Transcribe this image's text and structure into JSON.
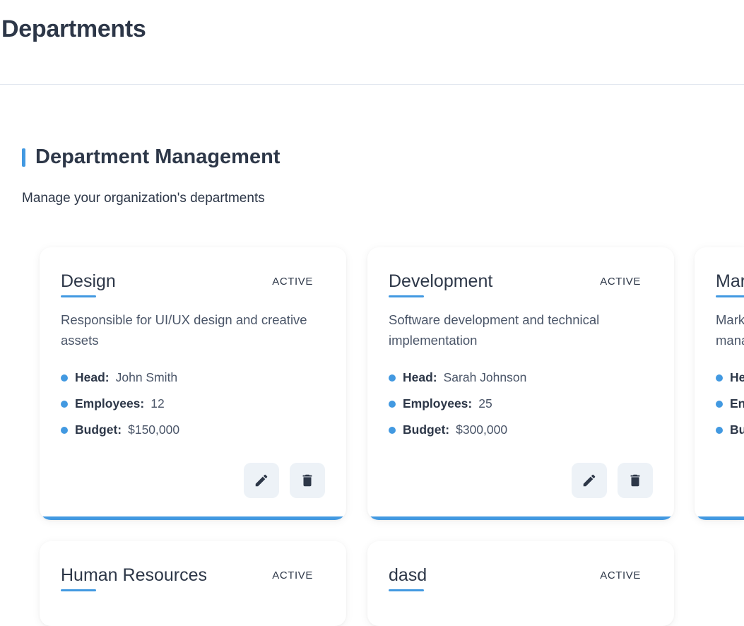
{
  "header": {
    "title": "Departments"
  },
  "section": {
    "title": "Department Management",
    "subtitle": "Manage your organization's departments"
  },
  "labels": {
    "head": "Head:",
    "employees": "Employees:",
    "budget": "Budget:"
  },
  "colors": {
    "accent": "#4299e1",
    "text": "#2d3748",
    "muted": "#4a5568",
    "button_bg": "#edf2f7"
  },
  "icons": {
    "edit": "pencil-icon",
    "delete": "trash-icon"
  },
  "departments": [
    {
      "name": "Design",
      "status": "ACTIVE",
      "description": "Responsible for UI/UX design and creative assets",
      "head": "John Smith",
      "employees": "12",
      "budget": "$150,000"
    },
    {
      "name": "Development",
      "status": "ACTIVE",
      "description": "Software development and technical implementation",
      "head": "Sarah Johnson",
      "employees": "25",
      "budget": "$300,000"
    },
    {
      "name": "Mar",
      "status": "",
      "description": "Mark mana",
      "head": "",
      "employees": "",
      "budget": ""
    },
    {
      "name": "Human Resources",
      "status": "ACTIVE"
    },
    {
      "name": "dasd",
      "status": "ACTIVE"
    }
  ],
  "third_card_partial": {
    "name": "Mar",
    "desc_line1": "Mark",
    "desc_line2": "mana",
    "labels": [
      "He",
      "En",
      "Bu"
    ]
  }
}
